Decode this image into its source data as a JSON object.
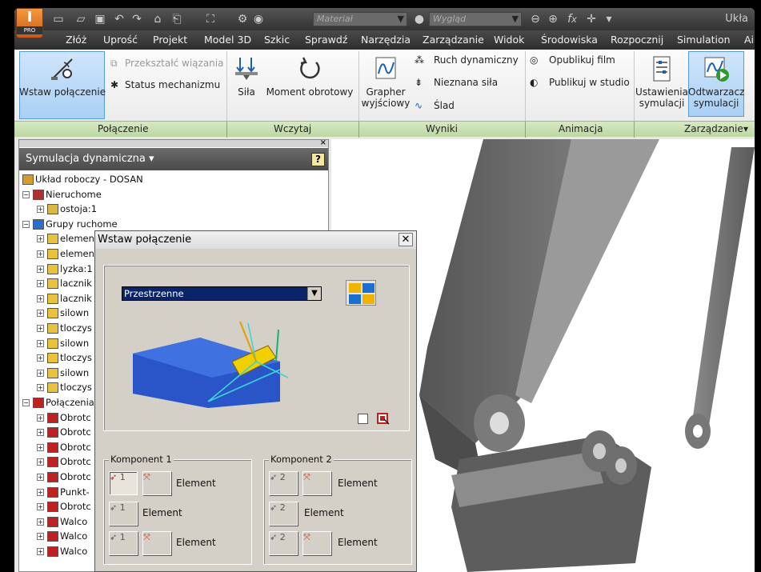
{
  "quick_access": {
    "app_badge": "PRO",
    "material_placeholder": "Materiał",
    "appearance_placeholder": "Wygląd",
    "window_title": "Ukła"
  },
  "menu": {
    "items": [
      "Złóż",
      "Uprość",
      "Projekt",
      "Model 3D",
      "Szkic",
      "Sprawdź",
      "Narzędzia",
      "Zarządzanie",
      "Widok",
      "Środowiska",
      "Rozpocznij",
      "Simulation",
      "Ai"
    ]
  },
  "ribbon": {
    "insert_joint": "Wstaw połączenie",
    "convert_constraints": "Przekształć wiązania",
    "mechanism_status": "Status mechanizmu",
    "force": "Siła",
    "torque": "Moment obrotowy",
    "output_grapher_line1": "Grapher",
    "output_grapher_line2": "wyjściowy",
    "dynamic_motion": "Ruch dynamiczny",
    "unknown_force": "Nieznana siła",
    "trace": "Ślad",
    "publish_movie": "Opublikuj film",
    "publish_studio": "Publikuj w studio",
    "sim_settings_line1": "Ustawienia",
    "sim_settings_line2": "symulacji",
    "sim_player_line1": "Odtwarzacz",
    "sim_player_line2": "symulacji",
    "panels": {
      "joint": "Połączenie",
      "load": "Wczytaj",
      "results": "Wyniki",
      "animation": "Animacja",
      "manage": "Zarządzanie"
    }
  },
  "browser": {
    "title": "Symulacja dynamiczna ▾",
    "help": "?",
    "close": "×",
    "tree": [
      {
        "label": "Układ roboczy - DOSAN",
        "level": 0,
        "icon": "assembly-icon",
        "expander": ""
      },
      {
        "label": "Nieruchome",
        "level": 0,
        "icon": "ground-icon",
        "expander": "−"
      },
      {
        "label": "ostoja:1",
        "level": 1,
        "icon": "grounded-part-icon",
        "expander": "+"
      },
      {
        "label": "Grupy ruchome",
        "level": 0,
        "icon": "mobile-group-icon",
        "expander": "−"
      },
      {
        "label": "element",
        "level": 1,
        "icon": "part-icon",
        "expander": "+"
      },
      {
        "label": "elemen",
        "level": 1,
        "icon": "part-icon",
        "expander": "+"
      },
      {
        "label": "lyzka:1",
        "level": 1,
        "icon": "part-icon",
        "expander": "+"
      },
      {
        "label": "lacznik",
        "level": 1,
        "icon": "part-icon",
        "expander": "+"
      },
      {
        "label": "lacznik",
        "level": 1,
        "icon": "part-icon",
        "expander": "+"
      },
      {
        "label": "silown",
        "level": 1,
        "icon": "part-icon",
        "expander": "+"
      },
      {
        "label": "tloczys",
        "level": 1,
        "icon": "part-icon",
        "expander": "+"
      },
      {
        "label": "silown",
        "level": 1,
        "icon": "part-icon",
        "expander": "+"
      },
      {
        "label": "tloczys",
        "level": 1,
        "icon": "part-icon",
        "expander": "+"
      },
      {
        "label": "silown",
        "level": 1,
        "icon": "part-icon",
        "expander": "+"
      },
      {
        "label": "tloczys",
        "level": 1,
        "icon": "part-icon",
        "expander": "+"
      },
      {
        "label": "Połączenia",
        "level": 0,
        "icon": "joints-icon",
        "expander": "−"
      },
      {
        "label": "Obrotc",
        "level": 1,
        "icon": "joint-icon",
        "expander": "+"
      },
      {
        "label": "Obrotc",
        "level": 1,
        "icon": "joint-icon",
        "expander": "+"
      },
      {
        "label": "Obrotc",
        "level": 1,
        "icon": "joint-icon",
        "expander": "+"
      },
      {
        "label": "Obrotc",
        "level": 1,
        "icon": "joint-icon",
        "expander": "+"
      },
      {
        "label": "Obrotc",
        "level": 1,
        "icon": "joint-icon",
        "expander": "+"
      },
      {
        "label": "Punkt-",
        "level": 1,
        "icon": "joint-icon",
        "expander": "+"
      },
      {
        "label": "Obrotc",
        "level": 1,
        "icon": "joint-icon",
        "expander": "+"
      },
      {
        "label": "Walco",
        "level": 1,
        "icon": "joint-icon",
        "expander": "+"
      },
      {
        "label": "Walco",
        "level": 1,
        "icon": "joint-icon",
        "expander": "+"
      },
      {
        "label": "Walco",
        "level": 1,
        "icon": "joint-icon",
        "expander": "+"
      }
    ]
  },
  "dialog": {
    "title": "Wstaw połączenie",
    "close": "✕",
    "joint_type": "Przestrzenne",
    "component1_label": "Komponent 1",
    "component2_label": "Komponent 2",
    "element_label": "Element",
    "pick1": "1",
    "pick2": "2"
  },
  "colors": {
    "menubar": "#333333",
    "panel_bar": "#c8e0b0",
    "selected_button": "#b8d9f7",
    "dialog_bg": "#d4d0c8",
    "joint_dropdown": "#0a246a"
  }
}
